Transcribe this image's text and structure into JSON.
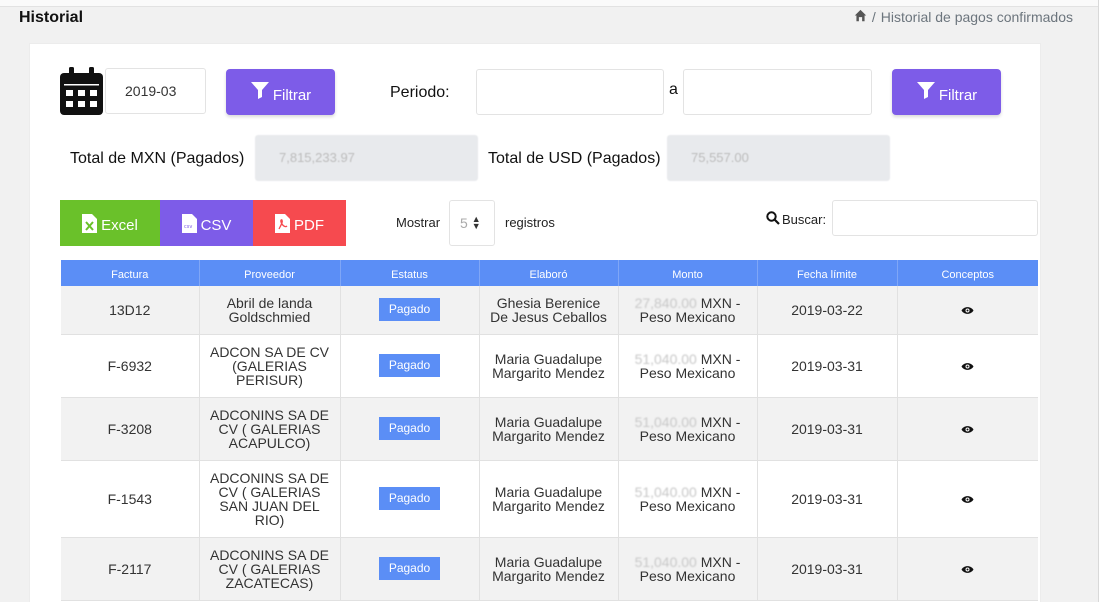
{
  "header": {
    "title": "Historial",
    "breadcrumb_sep": "/",
    "breadcrumb_current": "Historial de pagos confirmados"
  },
  "filters": {
    "month_value": "2019-03",
    "filter_label": "Filtrar",
    "period_label": "Periodo:",
    "period_separator": "a",
    "period_from": "",
    "period_to": "",
    "filter2_label": "Filtrar"
  },
  "totals": {
    "mxn_label": "Total de MXN (Pagados)",
    "mxn_value": "7,815,233.97",
    "usd_label": "Total de USD (Pagados)",
    "usd_value": "75,557.00"
  },
  "export": {
    "excel_label": "Excel",
    "csv_label": "CSV",
    "pdf_label": "PDF",
    "excel_color": "#6ac12a",
    "csv_color": "#7d5ce8",
    "pdf_color": "#f64a4f"
  },
  "length": {
    "show_label": "Mostrar",
    "value": "5",
    "records_label": "registros"
  },
  "search": {
    "label": "Buscar:",
    "value": ""
  },
  "table": {
    "header_color": "#5b8ef6",
    "columns": [
      "Factura",
      "Proveedor",
      "Estatus",
      "Elaboró",
      "Monto",
      "Fecha límite",
      "Conceptos"
    ],
    "rows": [
      {
        "factura": "13D12",
        "proveedor": [
          "Abril de landa",
          "Goldschmied"
        ],
        "estatus": "Pagado",
        "elaboro": [
          "Ghesia Berenice",
          "De Jesus Ceballos"
        ],
        "monto_amount": "27,840.00",
        "monto_currency": "MXN -",
        "monto_desc": "Peso Mexicano",
        "fecha": "2019-03-22"
      },
      {
        "factura": "F-6932",
        "proveedor": [
          "ADCON SA DE CV",
          "(GALERIAS",
          "PERISUR)"
        ],
        "estatus": "Pagado",
        "elaboro": [
          "Maria Guadalupe",
          "Margarito Mendez"
        ],
        "monto_amount": "51,040.00",
        "monto_currency": "MXN -",
        "monto_desc": "Peso Mexicano",
        "fecha": "2019-03-31"
      },
      {
        "factura": "F-3208",
        "proveedor": [
          "ADCONINS SA DE",
          "CV ( GALERIAS",
          "ACAPULCO)"
        ],
        "estatus": "Pagado",
        "elaboro": [
          "Maria Guadalupe",
          "Margarito Mendez"
        ],
        "monto_amount": "51,040.00",
        "monto_currency": "MXN -",
        "monto_desc": "Peso Mexicano",
        "fecha": "2019-03-31"
      },
      {
        "factura": "F-1543",
        "proveedor": [
          "ADCONINS SA DE",
          "CV ( GALERIAS",
          "SAN JUAN DEL",
          "RIO)"
        ],
        "estatus": "Pagado",
        "elaboro": [
          "Maria Guadalupe",
          "Margarito Mendez"
        ],
        "monto_amount": "51,040.00",
        "monto_currency": "MXN -",
        "monto_desc": "Peso Mexicano",
        "fecha": "2019-03-31"
      },
      {
        "factura": "F-2117",
        "proveedor": [
          "ADCONINS SA DE",
          "CV ( GALERIAS",
          "ZACATECAS)"
        ],
        "estatus": "Pagado",
        "elaboro": [
          "Maria Guadalupe",
          "Margarito Mendez"
        ],
        "monto_amount": "51,040.00",
        "monto_currency": "MXN -",
        "monto_desc": "Peso Mexicano",
        "fecha": "2019-03-31"
      }
    ]
  }
}
